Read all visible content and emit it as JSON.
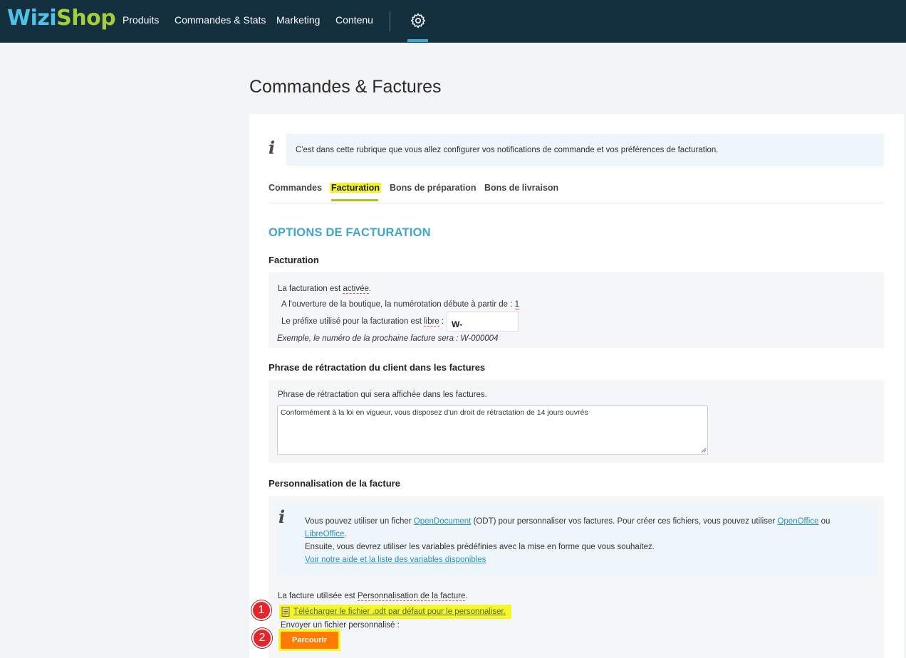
{
  "topbar": {
    "logo_part1": "Wizi",
    "logo_part2": "Shop",
    "nav": [
      "Produits",
      "Commandes & Stats",
      "Marketing",
      "Contenu"
    ],
    "settings_icon": "gear-icon"
  },
  "page": {
    "title": "Commandes & Factures"
  },
  "info_banner": {
    "icon": "info-icon",
    "text": "C'est dans cette rubrique que vous allez configurer vos notifications de commande et vos préférences de facturation."
  },
  "tabs": [
    {
      "label": "Commandes",
      "active": false
    },
    {
      "label": "Facturation",
      "active": true
    },
    {
      "label": "Bons de préparation",
      "active": false
    },
    {
      "label": "Bons de livraison",
      "active": false
    }
  ],
  "section": {
    "title": "OPTIONS DE FACTURATION"
  },
  "facturation": {
    "heading": "Facturation",
    "status_prefix": "La facturation est ",
    "status_value": "activée",
    "status_suffix": ".",
    "numbering_prefix": "A l'ouverture de la boutique, la numérotation débute à partir de : ",
    "numbering_value": "1",
    "prefix_label_start": "Le préfixe utilisé pour la facturation est ",
    "prefix_label_value": "libre",
    "prefix_label_end": " :",
    "prefix_input_value": "W-",
    "example": "Exemple, le numéro de la prochaine facture sera : W-000004"
  },
  "retractation": {
    "heading": "Phrase de rétractation du client dans les factures",
    "label": "Phrase de rétractation qui sera affichée dans les factures.",
    "textarea_value": "Conformément à la loi en vigueur, vous disposez d'un droit de rétractation de 14 jours ouvrés"
  },
  "personnalisation": {
    "heading": "Personnalisation de la facture",
    "info_icon": "info-icon",
    "info_line1_a": "Vous pouvez utiliser un ficher ",
    "info_link_opendocument": "OpenDocument",
    "info_line1_b": " (ODT) pour personnaliser vos factures. Pour créer ces fichiers, vous pouvez utiliser ",
    "info_link_openoffice": "OpenOffice",
    "info_line1_c": " ou",
    "info_link_libreoffice": "LibreOffice",
    "info_line2_end": ".",
    "info_line3": "Ensuite, vous devrez utiliser les variables prédéfinies avec la mise en forme que vous souhaitez.",
    "info_link_help": "Voir notre aide et la liste des variables disponibles",
    "used_prefix": "La facture utilisée est ",
    "used_value": "Personnalisation de la facture",
    "used_suffix": ".",
    "download_icon": "document-icon",
    "download_link": "Télécharger le fichier .odt par défaut pour le personnaliser.",
    "upload_label": "Envoyer un fichier personnalisé :",
    "browse_button": "Parcourir"
  },
  "annotations": {
    "step1": "1",
    "step2": "2"
  },
  "colors": {
    "topbar_bg": "#14303f",
    "accent_blue": "#42a5c9",
    "highlight_yellow": "#f4f62a",
    "button_orange": "#ff7a00",
    "badge_red": "#e5242b"
  }
}
